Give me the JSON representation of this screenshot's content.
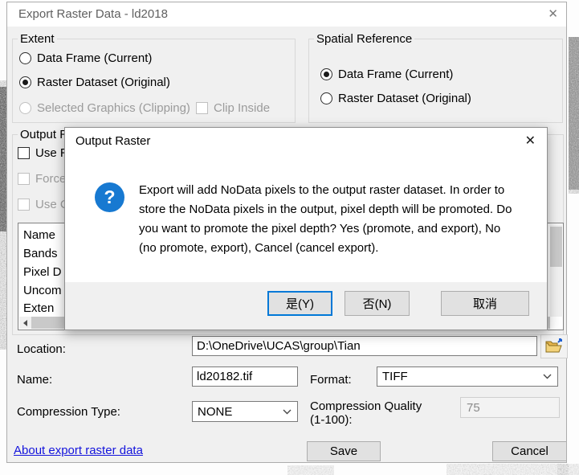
{
  "window": {
    "title": "Export Raster Data - ld2018",
    "close_icon": "✕"
  },
  "extent": {
    "title": "Extent",
    "radio_data_frame": "Data Frame (Current)",
    "radio_raster_dataset": "Raster Dataset (Original)",
    "radio_selected_graphics": "Selected Graphics (Clipping)",
    "clip_inside": "Clip Inside"
  },
  "spatial_reference": {
    "title": "Spatial Reference",
    "radio_data_frame": "Data Frame (Current)",
    "radio_raster_dataset": "Raster Dataset (Original)"
  },
  "output_raster_section": {
    "title_visible": "Output R",
    "checkbox_1_visible": "Use R",
    "checkbox_2_visible": "Force",
    "checkbox_3_visible": "Use C",
    "properties_visible": [
      "Name",
      "Bands",
      "Pixel D",
      "Uncom",
      "Exten"
    ]
  },
  "modal": {
    "title": "Output Raster",
    "close_icon": "✕",
    "question_icon": "?",
    "message": "Export will add NoData pixels to the output raster dataset. In order to store the NoData pixels in the output, pixel depth will be promoted. Do you want to promote the pixel depth?  Yes (promote, and export), No (no promote, export), Cancel (cancel export).",
    "yes_button": "是(Y)",
    "no_button": "否(N)",
    "cancel_button": "取消"
  },
  "fields": {
    "location_label": "Location:",
    "location_value": "D:\\OneDrive\\UCAS\\group\\Tian",
    "name_label": "Name:",
    "name_value": "ld20182.tif",
    "format_label": "Format:",
    "format_value": "TIFF",
    "compression_type_label": "Compression Type:",
    "compression_type_value": "NONE",
    "compression_quality_label_line1": "Compression Quality",
    "compression_quality_label_line2": "(1-100):",
    "compression_quality_value": "75"
  },
  "footer": {
    "about_link": "About export raster data",
    "save_button": "Save",
    "cancel_button": "Cancel"
  },
  "colors": {
    "accent_blue": "#0078d7",
    "question_icon_blue": "#1779d1",
    "link_blue": "#1414dc",
    "folder_yellow": "#e8b64c",
    "dialog_bg": "#f0f0f0"
  }
}
